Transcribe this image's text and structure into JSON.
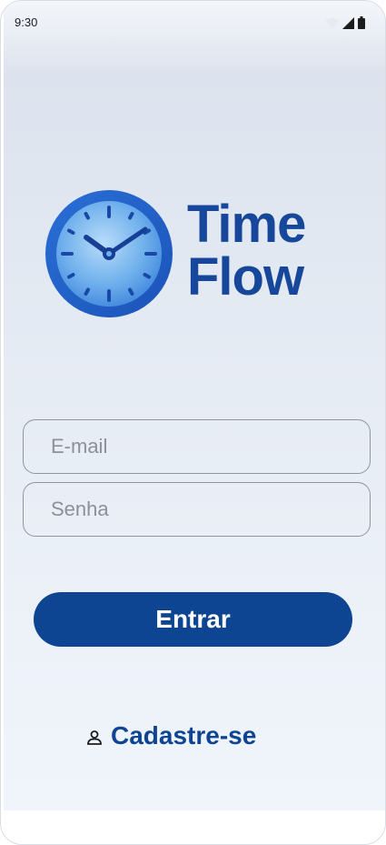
{
  "status_bar": {
    "time": "9:30",
    "icons": [
      "wifi-icon",
      "signal-icon",
      "battery-icon"
    ]
  },
  "brand": {
    "line1": "Time",
    "line2": "Flow",
    "color": "#17479b",
    "icon": "clock-icon"
  },
  "form": {
    "email_placeholder": "E-mail",
    "email_value": "",
    "password_placeholder": "Senha",
    "password_value": ""
  },
  "actions": {
    "login_label": "Entrar",
    "login_color": "#0e4592",
    "signup_label": "Cadastre-se",
    "signup_icon": "user-icon"
  }
}
